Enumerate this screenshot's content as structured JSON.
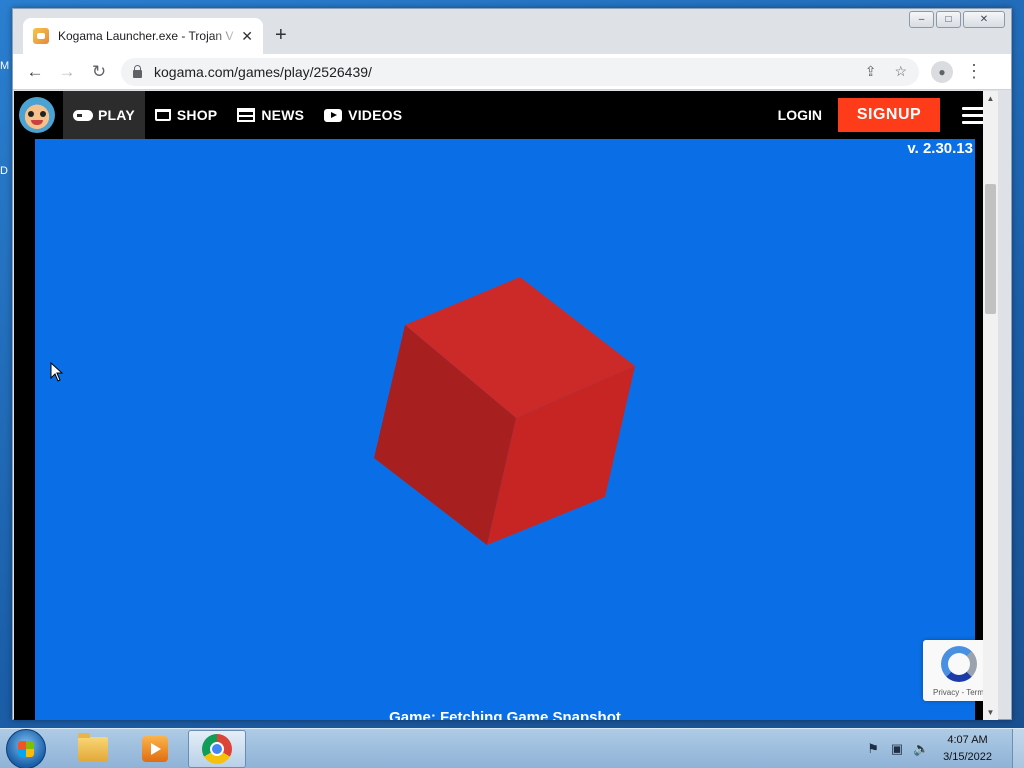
{
  "desktop": {
    "edge_letters": [
      "M",
      "D"
    ]
  },
  "browser": {
    "tab": {
      "title": "Kogama Launcher.exe - Trojan V",
      "close": "✕"
    },
    "new_tab": "+",
    "address": "kogama.com/games/play/2526439/",
    "window_controls": {
      "minimize": "–",
      "maximize": "□",
      "close": "✕"
    }
  },
  "site": {
    "nav": {
      "play": "PLAY",
      "shop": "SHOP",
      "news": "NEWS",
      "videos": "VIDEOS",
      "login": "LOGIN",
      "signup": "SIGNUP"
    },
    "colors": {
      "signup": "#ff3c1a",
      "game_bg": "#0a6fe6",
      "cube": "#c92323"
    }
  },
  "game": {
    "version": "v. 2.30.13",
    "status": "Game: Fetching Game Snapshot"
  },
  "recaptcha": {
    "links": "Privacy - Terms"
  },
  "taskbar": {
    "items": [
      "windows-explorer",
      "media-player",
      "google-chrome"
    ],
    "active": "google-chrome",
    "clock": {
      "time": "4:07 AM",
      "date": "3/15/2022"
    }
  }
}
